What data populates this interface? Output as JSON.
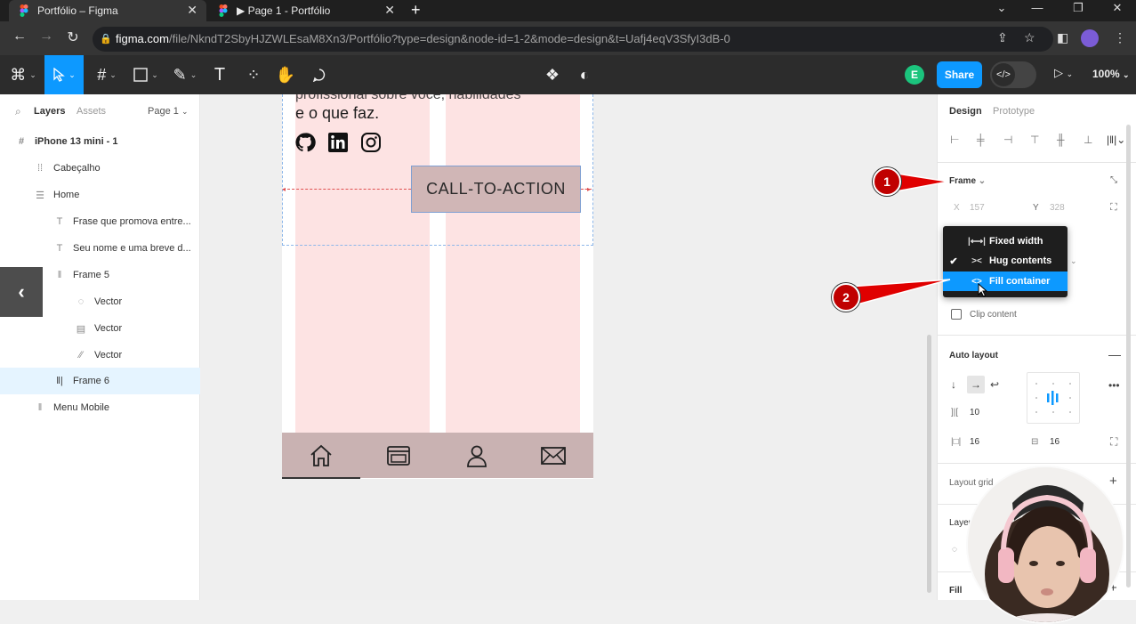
{
  "browser": {
    "tabs": [
      {
        "title": "Portfólio – Figma",
        "active": true
      },
      {
        "title": "▶ Page 1 - Portfólio",
        "active": false
      }
    ],
    "url_host": "figma.com",
    "url_path": "/file/NkndT2SbyHJZWLEsaM8Xn3/Portfólio?type=design&node-id=1-2&mode=design&t=Uafj4eqV3SfyI3dB-0"
  },
  "toolbar": {
    "share_label": "Share",
    "avatar_initial": "E",
    "zoom": "100%",
    "dev_mode_glyph": "</>"
  },
  "left_panel": {
    "tabs": [
      "Layers",
      "Assets"
    ],
    "page": "Page 1",
    "layers": [
      {
        "name": "iPhone 13 mini - 1",
        "icon": "frame-icon"
      },
      {
        "name": "Cabeçalho",
        "icon": "auto-layout-grid-icon"
      },
      {
        "name": "Home",
        "icon": "auto-layout-vertical-icon"
      },
      {
        "name": "Frase que promova entre...",
        "icon": "text-icon"
      },
      {
        "name": "Seu nome e uma breve d...",
        "icon": "text-icon"
      },
      {
        "name": "Frame 5",
        "icon": "auto-layout-horizontal-icon"
      },
      {
        "name": "Vector",
        "icon": "vector-icon"
      },
      {
        "name": "Vector",
        "icon": "vector-icon"
      },
      {
        "name": "Vector",
        "icon": "vector-icon"
      },
      {
        "name": "Frame 6",
        "icon": "auto-layout-horizontal-icon"
      },
      {
        "name": "Menu Mobile",
        "icon": "auto-layout-horizontal-icon"
      }
    ]
  },
  "canvas": {
    "bio_cut": "profissional sobre você, habilidades",
    "bio_line": "e o que faz.",
    "cta_label": "CALL-TO-ACTION"
  },
  "right_panel": {
    "tabs": [
      "Design",
      "Prototype"
    ],
    "frame_label": "Frame",
    "x_label": "X",
    "x_value": "157",
    "y_label": "Y",
    "y_value": "328",
    "clip_content": "Clip content",
    "auto_layout": "Auto layout",
    "gap": "10",
    "padding_h": "16",
    "padding_v": "16",
    "layout_grid": "Layout grid",
    "layer": "Layer",
    "fill": "Fill"
  },
  "dropdown": {
    "items": [
      {
        "label": "Fixed width",
        "checked": false,
        "highlighted": false
      },
      {
        "label": "Hug contents",
        "checked": true,
        "highlighted": false
      },
      {
        "label": "Fill container",
        "checked": false,
        "highlighted": true
      }
    ]
  },
  "callouts": [
    "1",
    "2"
  ],
  "slide_nav": {
    "prev": "‹",
    "next": "›"
  },
  "colors": {
    "accent": "#0d99ff",
    "callout": "#c00000",
    "column": "#fde3e3"
  }
}
